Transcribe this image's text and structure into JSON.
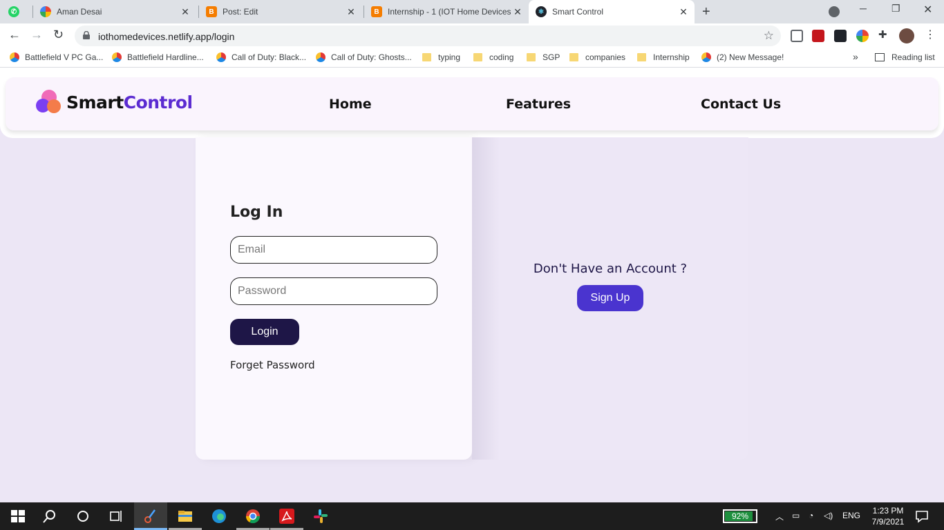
{
  "browser": {
    "tabs": [
      {
        "title": "",
        "icon": "whatsapp-icon"
      },
      {
        "title": "Aman Desai",
        "icon": "google-icon"
      },
      {
        "title": "Post: Edit",
        "icon": "blogger-icon"
      },
      {
        "title": "Internship - 1 (IOT Home Devices",
        "icon": "blogger-icon"
      },
      {
        "title": "Smart Control",
        "icon": "react-icon"
      }
    ],
    "url": "iothomedevices.netlify.app/login",
    "bookmarks": [
      "Battlefield V PC Ga...",
      "Battlefield Hardline...",
      "Call of Duty: Black...",
      "Call of Duty: Ghosts...",
      "typing",
      "coding",
      "SGP",
      "companies",
      "Internship",
      "(2) New Message!"
    ],
    "more": "»",
    "reading_list": "Reading list"
  },
  "site": {
    "logo_part1": "Smart",
    "logo_part2": "Control",
    "nav": [
      "Home",
      "Features",
      "Contact Us"
    ]
  },
  "login": {
    "title": "Log In",
    "email_placeholder": "Email",
    "password_placeholder": "Password",
    "login_label": "Login",
    "forget_label": "Forget Password"
  },
  "signup": {
    "prompt": "Don't Have an Account ?",
    "button_label": "Sign Up"
  },
  "taskbar": {
    "battery": "92%",
    "battery_level": 0.92,
    "language": "ENG",
    "time": "1:23 PM",
    "date": "7/9/2021"
  }
}
